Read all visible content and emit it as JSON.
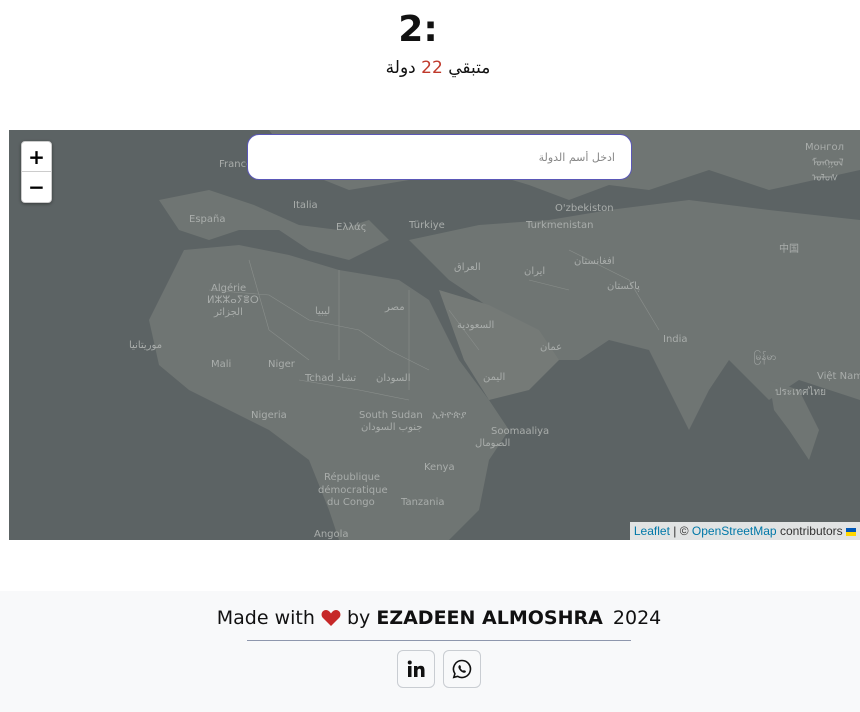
{
  "header": {
    "timer": "2:",
    "remaining_prefix": "متبقي",
    "remaining_count": "22",
    "remaining_suffix": "دولة"
  },
  "map": {
    "search_placeholder": "ادخل أسم الدولة",
    "zoom_in_label": "+",
    "zoom_out_label": "−",
    "labels": {
      "france": "France",
      "espana": "España",
      "italia": "Italia",
      "ellas": "Ελλάς",
      "turkiye": "Türkiye",
      "uzbekiston": "O'zbekiston",
      "turkmenistan": "Turkmenistan",
      "mongol": "Монгол",
      "mongol_script1": "ᠮᠣᠩᠭᠣᠯ",
      "mongol_script2": "ᠤᠯᠤᠰ",
      "zhongguo": "中国",
      "iraq": "العراق",
      "iran": "ایران",
      "afghanistan": "افغانستان",
      "pakistan": "پاکستان",
      "algerie1": "Algérie",
      "algerie2": "ⵍⵣⵣⴰⵢⴻⵔ",
      "algerie3": "الجزائر",
      "libya": "ليبيا",
      "misr": "مصر",
      "saudi": "السعودية",
      "oman": "عمان",
      "india": "India",
      "myanmar": "မြန်မာ",
      "mauritania": "موريتانيا",
      "mali": "Mali",
      "niger": "Niger",
      "tchad": "Tchad تشاد",
      "sudan": "السودان",
      "yemen": "اليمن",
      "vietnam": "Việt Nam",
      "thailand": "ประเทศไทย",
      "nigeria": "Nigeria",
      "south_sudan1": "South Sudan",
      "south_sudan2": "جنوب السودان",
      "ethiopia": "ኢትዮጵያ",
      "somalia1": "Soomaaliya",
      "somalia2": "الصومال",
      "kenya": "Kenya",
      "drc1": "République",
      "drc2": "démocratique",
      "drc3": "du Congo",
      "tanzania": "Tanzania",
      "angola": "Angola"
    },
    "attribution": {
      "leaflet": "Leaflet",
      "separator": "| ©",
      "osm": "OpenStreetMap",
      "contributors": "contributors"
    }
  },
  "footer": {
    "made_with": "Made with",
    "by": "by",
    "author": "EZADEEN ALMOSHRA",
    "year": "2024"
  },
  "colors": {
    "map_background": "#5c6364",
    "accent_count": "#c0392b",
    "heart": "#c62828",
    "search_border": "#5a57b7"
  }
}
